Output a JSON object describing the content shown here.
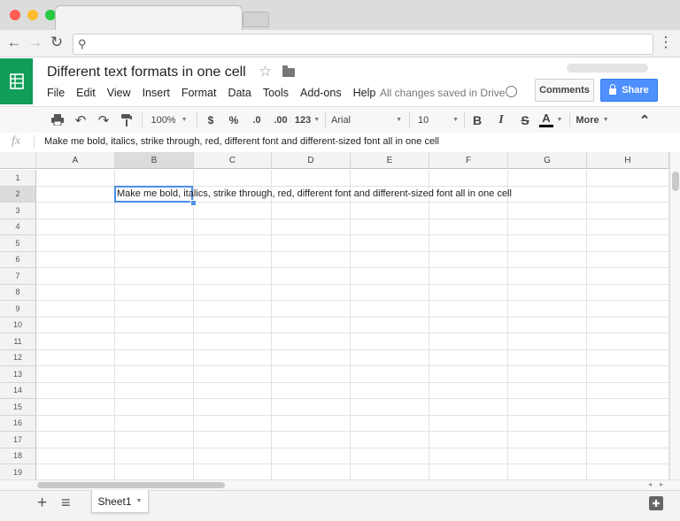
{
  "browser": {
    "nav": {
      "back_icon": "←",
      "forward_icon": "→",
      "reload_icon": "↻",
      "menu_icon": "⋮",
      "search_icon": "⚲"
    }
  },
  "app": {
    "title": "Different text formats in one cell",
    "star_icon": "☆",
    "menus": [
      "File",
      "Edit",
      "View",
      "Insert",
      "Format",
      "Data",
      "Tools",
      "Add-ons",
      "Help"
    ],
    "saved_status": "All changes saved in Drive",
    "comments_label": "Comments",
    "share_label": "Share",
    "brand_color": "#0f9d58",
    "share_color": "#4d90fe"
  },
  "toolbar": {
    "zoom": "100%",
    "currency": "$",
    "percent": "%",
    "decrease_decimals": ".0",
    "increase_decimals": ".00",
    "more_formats": "123",
    "font": "Arial",
    "font_size": "10",
    "bold": "B",
    "italic": "I",
    "strikethrough": "S",
    "text_color": "A",
    "more_label": "More",
    "collapse_icon": "⌃"
  },
  "formula_bar": {
    "fx_label": "fx",
    "content": "Make me bold, italics, strike through, red, different font and different-sized font all in one cell"
  },
  "grid": {
    "columns": [
      "A",
      "B",
      "C",
      "D",
      "E",
      "F",
      "G",
      "H"
    ],
    "rows": [
      "1",
      "2",
      "3",
      "4",
      "5",
      "6",
      "7",
      "8",
      "9",
      "10",
      "11",
      "12",
      "13",
      "14",
      "15",
      "16",
      "17",
      "18",
      "19"
    ],
    "selected_cell": "B2",
    "cell_b2": "Make me bold, italics, strike through, red, different font and different-sized font all in one cell"
  },
  "bottom": {
    "add_sheet_icon": "+",
    "all_sheets_icon": "≡",
    "sheet_name": "Sheet1",
    "explore_icon": "✚"
  }
}
